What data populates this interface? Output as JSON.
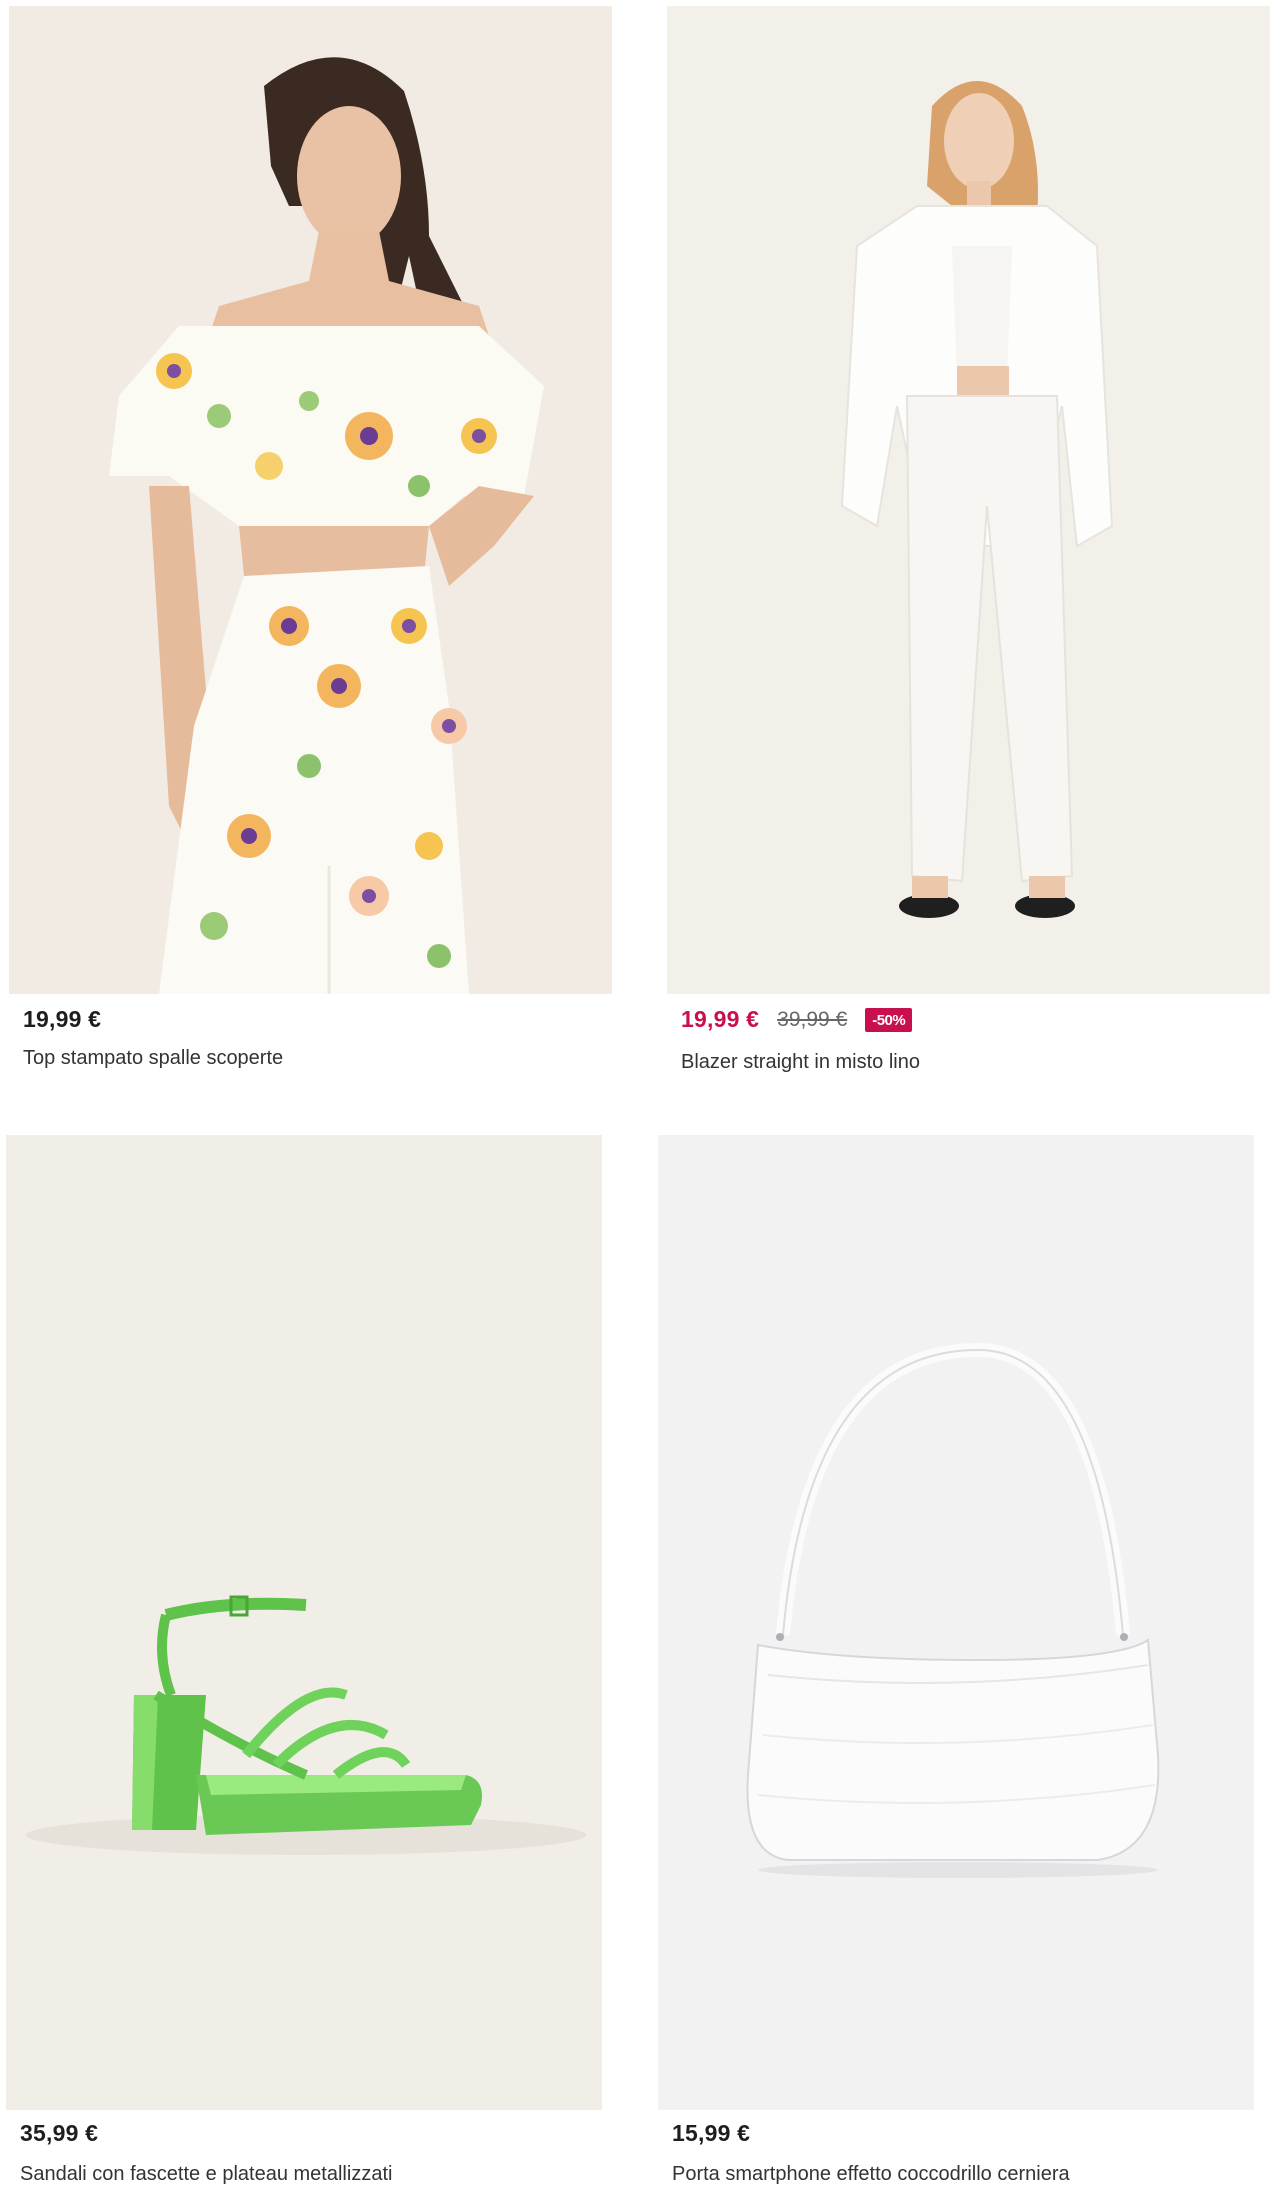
{
  "products": [
    {
      "image_alt": "woman in floral off-shoulder crop top and matching trousers",
      "price": "19,99 €",
      "title": "Top stampato spalle scoperte"
    },
    {
      "image_alt": "woman in white linen blazer suit",
      "price": "19,99 €",
      "old_price": "39,99 €",
      "discount": "-50%",
      "title": "Blazer straight in misto lino"
    },
    {
      "image_alt": "green metallic platform sandal with straps",
      "price": "35,99 €",
      "title": "Sandali con fascette e plateau metallizzati"
    },
    {
      "image_alt": "white croc-effect shoulder bag",
      "price": "15,99 €",
      "title": "Porta smartphone effetto coccodrillo cerniera"
    }
  ],
  "colors": {
    "sale": "#c8104e",
    "text": "#1e1e1e"
  }
}
